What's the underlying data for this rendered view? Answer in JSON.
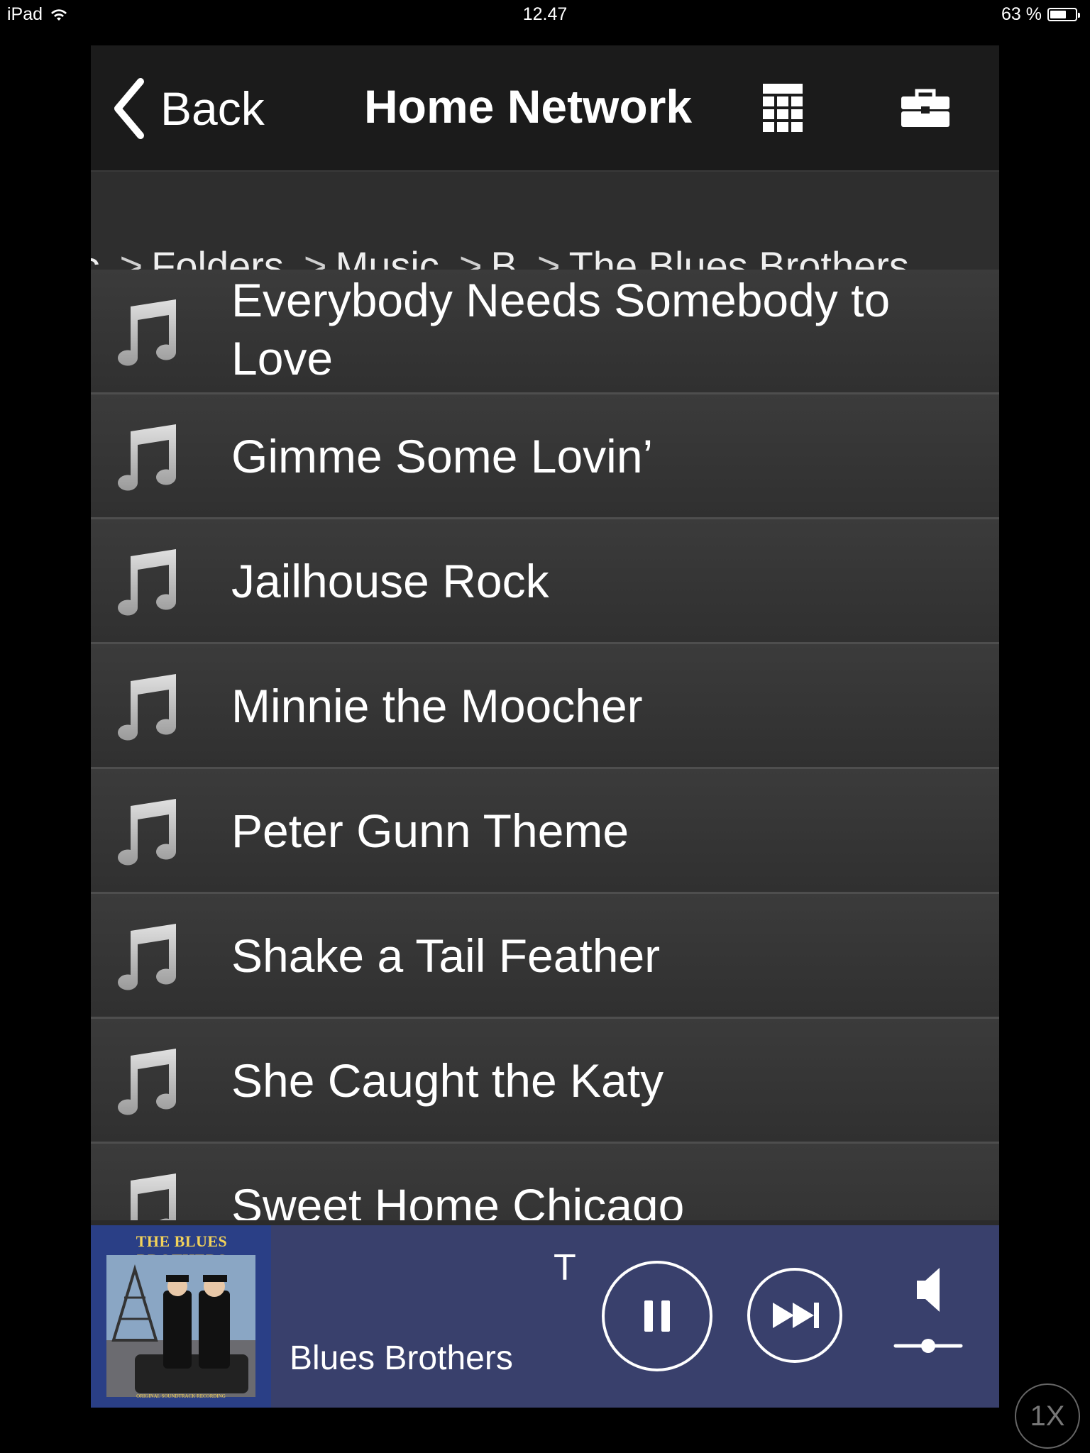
{
  "status_bar": {
    "device": "iPad",
    "time": "12.47",
    "battery": "63 %",
    "battery_level": 0.63
  },
  "nav": {
    "back_label": "Back",
    "title": "Home Network",
    "grid_icon": "grid-icon",
    "tools_icon": "toolbox-icon"
  },
  "breadcrumb": [
    {
      "label": "sic",
      "sep": ""
    },
    {
      "label": "Folders",
      "sep": ">"
    },
    {
      "label": "Music",
      "sep": ">"
    },
    {
      "label": "B",
      "sep": ">"
    },
    {
      "label": "The Blues Brothers",
      "sep": ">"
    }
  ],
  "tracks": [
    {
      "title_line1": "Everybody Needs Somebody to",
      "title_line2": "Love"
    },
    {
      "title_line1": "Gimme Some Lovin’",
      "title_line2": ""
    },
    {
      "title_line1": "Jailhouse Rock",
      "title_line2": ""
    },
    {
      "title_line1": "Minnie the Moocher",
      "title_line2": ""
    },
    {
      "title_line1": "Peter Gunn Theme",
      "title_line2": ""
    },
    {
      "title_line1": "Shake a Tail Feather",
      "title_line2": ""
    },
    {
      "title_line1": "She Caught the Katy",
      "title_line2": ""
    },
    {
      "title_line1": "Sweet Home Chicago",
      "title_line2": ""
    }
  ],
  "now_playing": {
    "album_cover_title": "THE BLUES BROTHERS",
    "album_cover_subtitle": "ORIGINAL SOUNDTRACK RECORDING",
    "track_fragment": "T",
    "artist": "Blues Brothers",
    "volume_level": 0.5
  },
  "zoom_badge": "1X"
}
